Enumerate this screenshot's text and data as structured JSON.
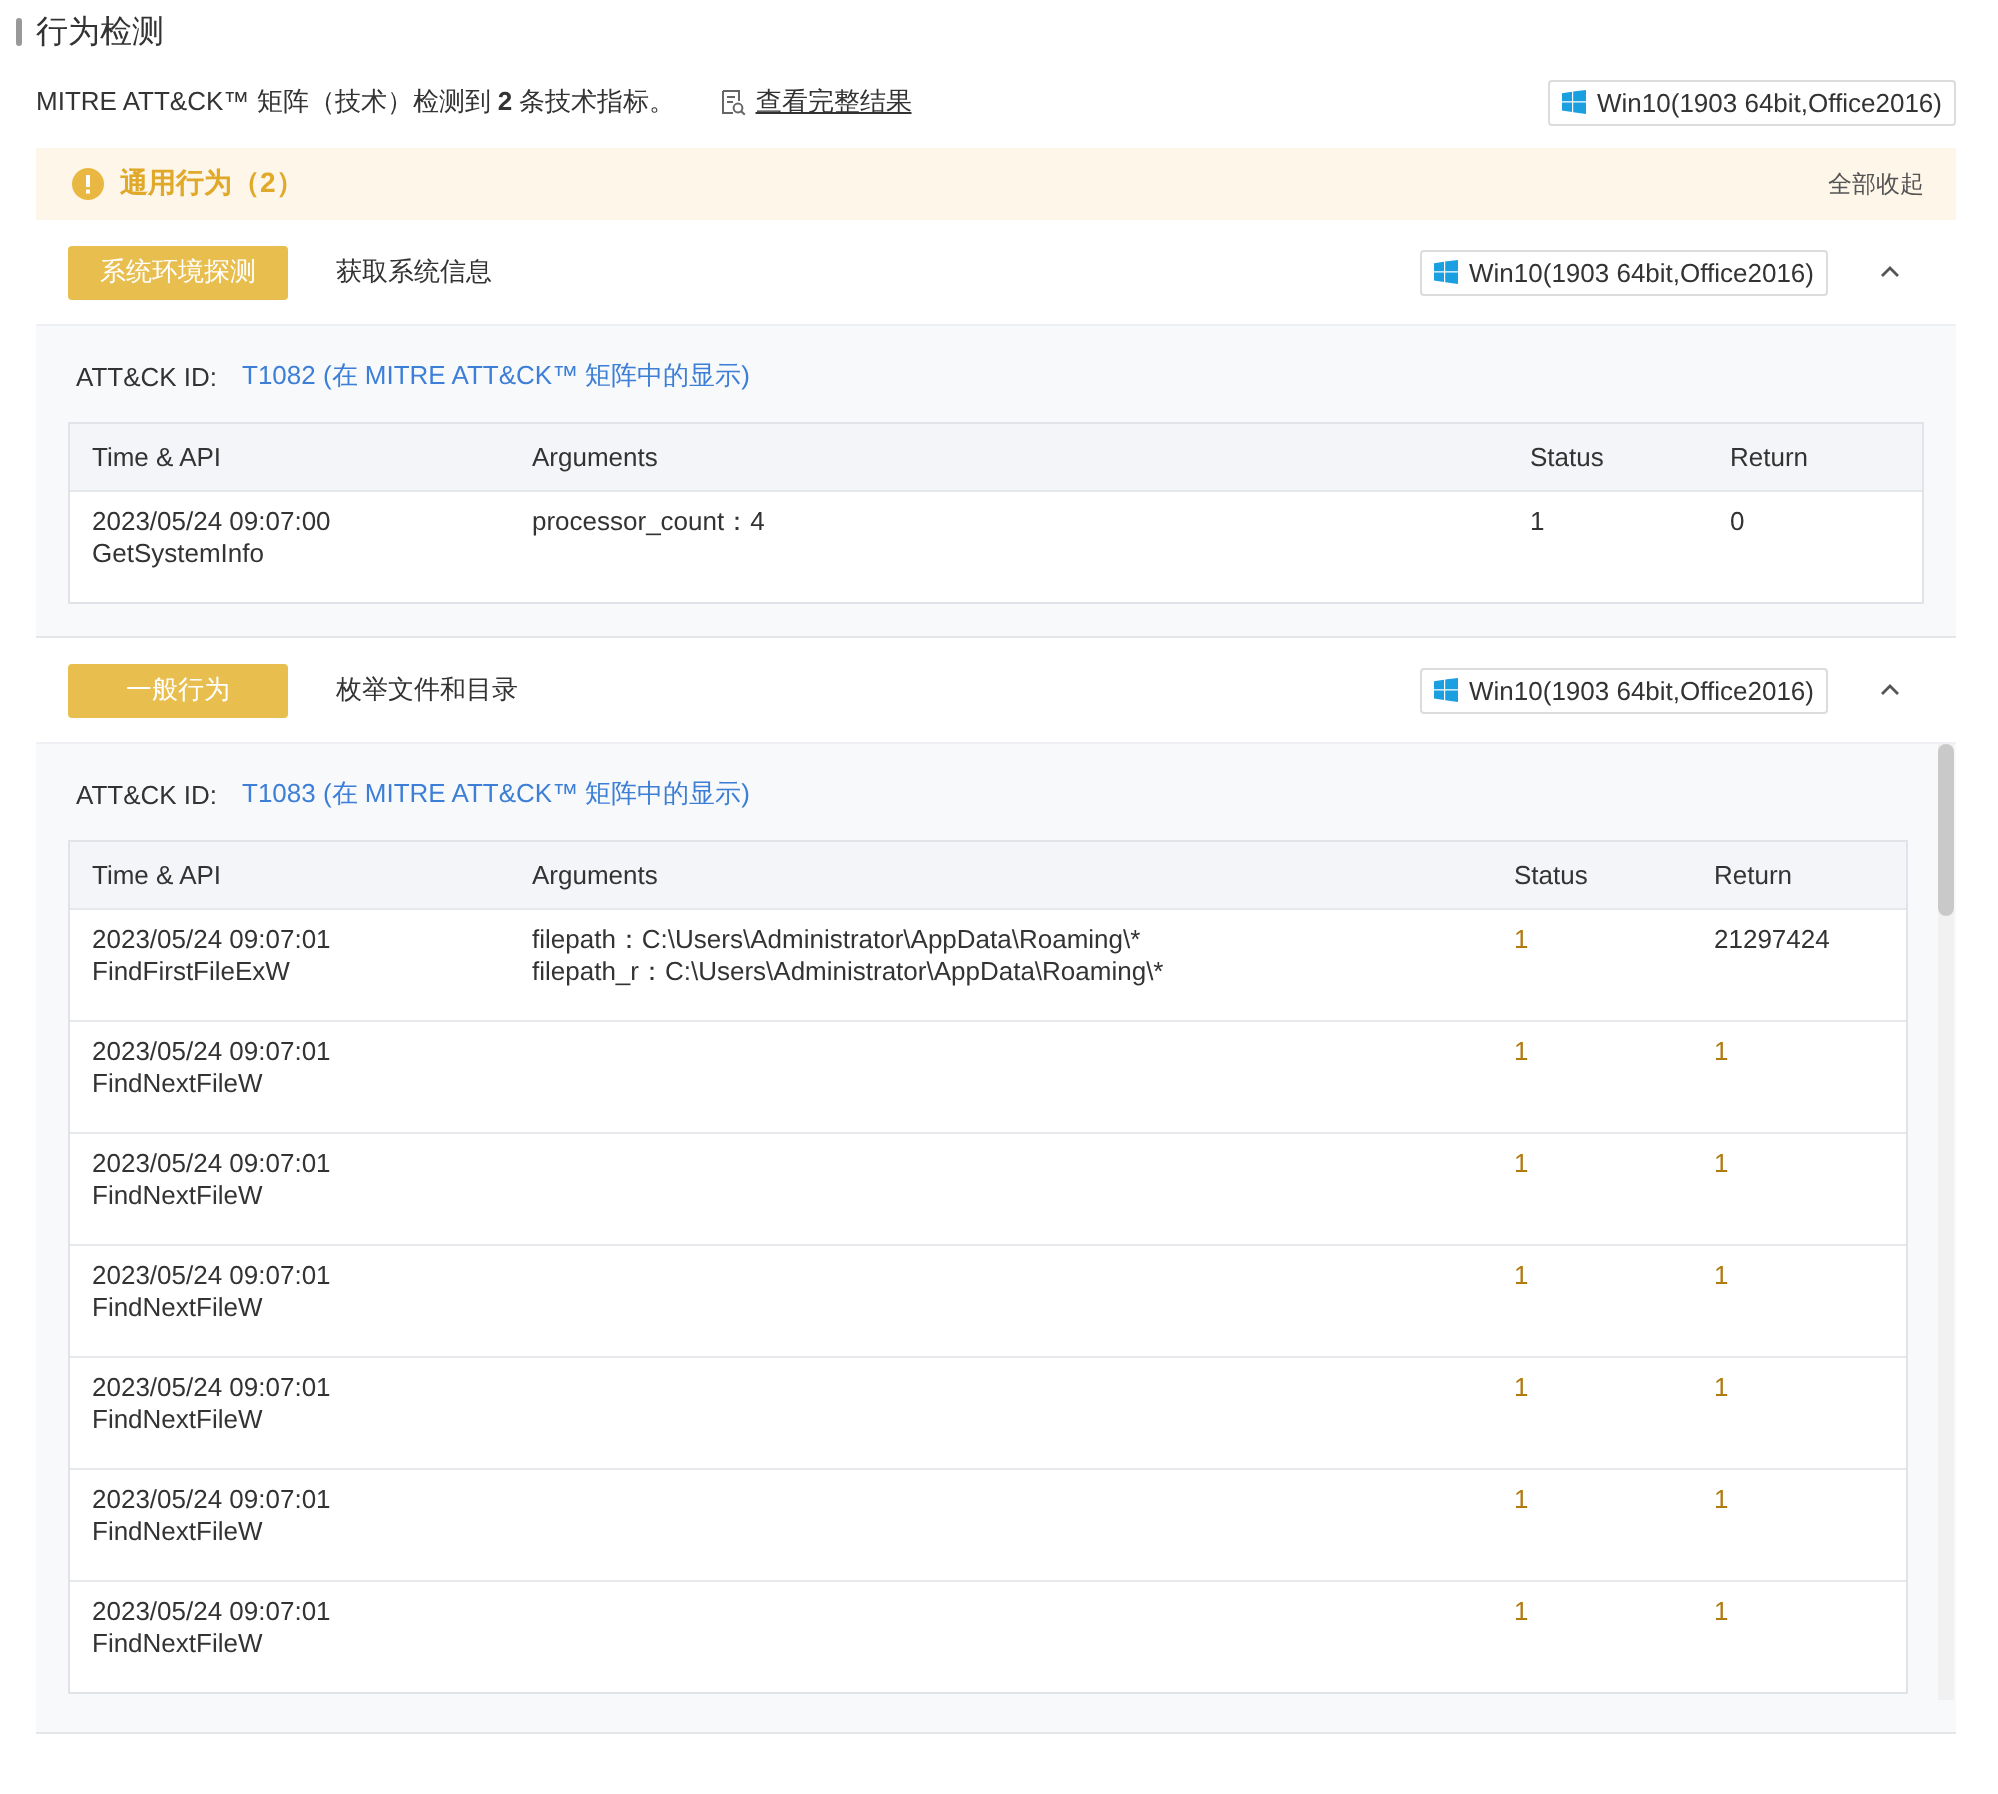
{
  "title": "行为检测",
  "summary": {
    "text": "MITRE ATT&CK™ 矩阵（技术）检测到 **2** 条技术指标。",
    "link": "查看完整结果",
    "env": "Win10(1903 64bit,Office2016)"
  },
  "group": {
    "title": "通用行为（2）",
    "action": "全部收起"
  },
  "behaviors": [
    {
      "tag": "系统环境探测",
      "name": "获取系统信息",
      "env": "Win10(1903 64bit,Office2016)",
      "expanded": true,
      "attck_label": "ATT&CK ID:",
      "attck_link": "T1082 (在 MITRE ATT&CK™ 矩阵中的显示)",
      "scrolled": false,
      "columns": [
        "Time & API",
        "Arguments",
        "Status",
        "Return"
      ],
      "rows": [
        {
          "time": "2023/05/24 09:07:00",
          "api": "GetSystemInfo",
          "arguments": [
            "processor_count：4"
          ],
          "status": "1",
          "status_flagged": false,
          "return": "0",
          "return_flagged": false
        }
      ]
    },
    {
      "tag": "一般行为",
      "name": "枚举文件和目录",
      "env": "Win10(1903 64bit,Office2016)",
      "expanded": true,
      "attck_label": "ATT&CK ID:",
      "attck_link": "T1083 (在 MITRE ATT&CK™ 矩阵中的显示)",
      "scrolled": true,
      "columns": [
        "Time & API",
        "Arguments",
        "Status",
        "Return"
      ],
      "rows": [
        {
          "time": "2023/05/24 09:07:01",
          "api": "FindFirstFileExW",
          "arguments": [
            "filepath：C:\\Users\\Administrator\\AppData\\Roaming\\*",
            "filepath_r：C:\\Users\\Administrator\\AppData\\Roaming\\*"
          ],
          "status": "1",
          "status_flagged": true,
          "return": "21297424",
          "return_flagged": false
        },
        {
          "time": "2023/05/24 09:07:01",
          "api": "FindNextFileW",
          "arguments": [],
          "status": "1",
          "status_flagged": true,
          "return": "1",
          "return_flagged": true
        },
        {
          "time": "2023/05/24 09:07:01",
          "api": "FindNextFileW",
          "arguments": [],
          "status": "1",
          "status_flagged": true,
          "return": "1",
          "return_flagged": true
        },
        {
          "time": "2023/05/24 09:07:01",
          "api": "FindNextFileW",
          "arguments": [],
          "status": "1",
          "status_flagged": true,
          "return": "1",
          "return_flagged": true
        },
        {
          "time": "2023/05/24 09:07:01",
          "api": "FindNextFileW",
          "arguments": [],
          "status": "1",
          "status_flagged": true,
          "return": "1",
          "return_flagged": true
        },
        {
          "time": "2023/05/24 09:07:01",
          "api": "FindNextFileW",
          "arguments": [],
          "status": "1",
          "status_flagged": true,
          "return": "1",
          "return_flagged": true
        },
        {
          "time": "2023/05/24 09:07:01",
          "api": "FindNextFileW",
          "arguments": [],
          "status": "1",
          "status_flagged": true,
          "return": "1",
          "return_flagged": true
        }
      ]
    }
  ]
}
